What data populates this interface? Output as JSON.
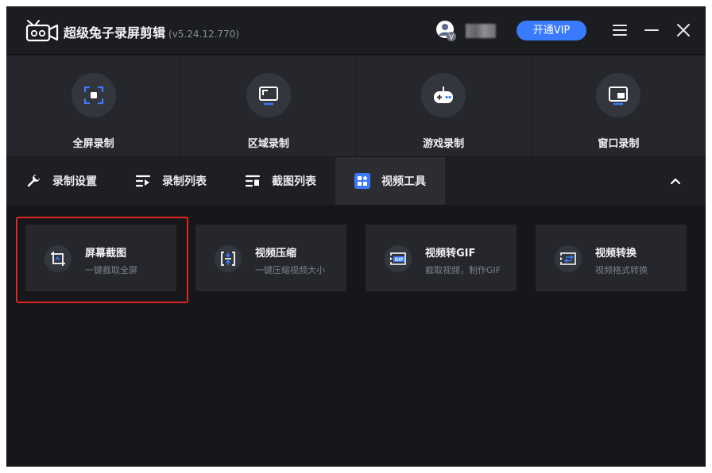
{
  "app": {
    "title": "超级兔子录屏剪辑",
    "version": "(v5.24.12.770)",
    "vip_button": "开通VIP"
  },
  "icons": {
    "logo": "rabbit-camera-logo",
    "menu": "hamburger-menu-icon",
    "minimize": "minimize-icon",
    "close": "close-icon",
    "avatar": "user-avatar-vip"
  },
  "colors": {
    "accent": "#3a7afe",
    "highlight": "#e0251f",
    "background": "#16171b"
  },
  "record_modes": [
    {
      "label": "全屏录制",
      "icon": "fullscreen-record-icon"
    },
    {
      "label": "区域录制",
      "icon": "region-record-icon"
    },
    {
      "label": "游戏录制",
      "icon": "gamepad-icon"
    },
    {
      "label": "窗口录制",
      "icon": "window-record-icon"
    }
  ],
  "tabs": [
    {
      "label": "录制设置",
      "icon": "wrench-icon"
    },
    {
      "label": "录制列表",
      "icon": "record-list-icon"
    },
    {
      "label": "截图列表",
      "icon": "screenshot-list-icon"
    },
    {
      "label": "视频工具",
      "icon": "grid-tools-icon",
      "active": true
    }
  ],
  "tools": [
    {
      "title": "屏幕截图",
      "subtitle": "一键截取全屏",
      "icon": "screenshot-crop-icon"
    },
    {
      "title": "视频压缩",
      "subtitle": "一键压缩视频大小",
      "icon": "compress-icon"
    },
    {
      "title": "视频转GIF",
      "subtitle": "截取视频，制作GIF",
      "icon": "gif-icon"
    },
    {
      "title": "视频转换",
      "subtitle": "视频格式转换",
      "icon": "convert-icon"
    }
  ]
}
